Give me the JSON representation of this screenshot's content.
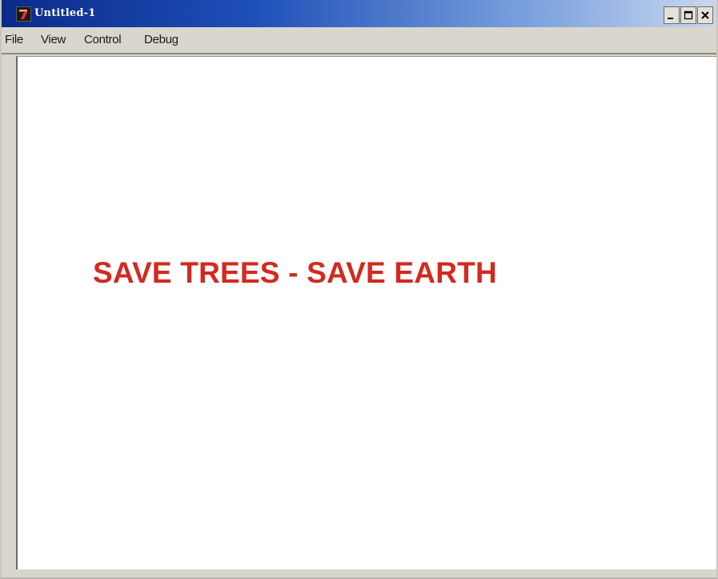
{
  "window": {
    "title": "Untitled-1",
    "app_icon": "director-app-icon",
    "controls": {
      "minimize": "minimize-icon",
      "maximize": "maximize-icon",
      "close": "close-icon"
    }
  },
  "menu": {
    "items": [
      {
        "label": "File"
      },
      {
        "label": "View"
      },
      {
        "label": "Control"
      },
      {
        "label": "Debug"
      }
    ]
  },
  "stage": {
    "text": "SAVE TREES - SAVE EARTH",
    "text_color": "#d22a1f"
  },
  "colors": {
    "titlebar_start": "#0c2a8a",
    "titlebar_end": "#c9d7ef",
    "chrome": "#d9d6cd",
    "stage_background": "#ffffff"
  }
}
